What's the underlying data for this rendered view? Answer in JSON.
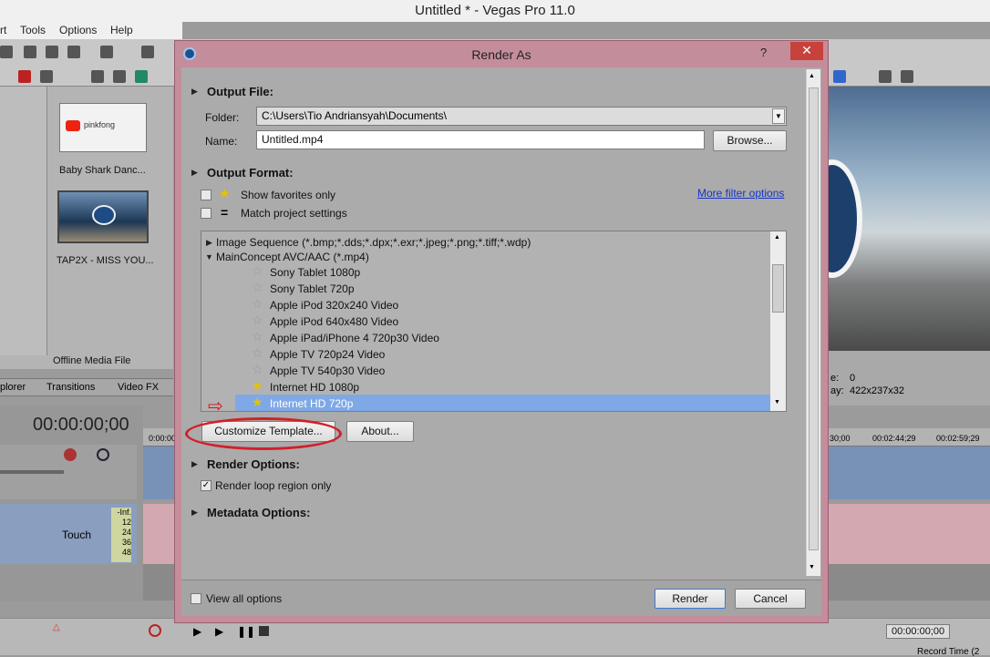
{
  "app": {
    "title": "Untitled * - Vegas Pro 11.0",
    "menu": [
      "rt",
      "Tools",
      "Options",
      "Help"
    ]
  },
  "media": {
    "items": [
      "Baby Shark Danc...",
      "TAP2X - MISS YOU..."
    ],
    "thumb1_text": "pinkfong",
    "panel_label": "Offline Media File",
    "tabs": [
      "plorer",
      "Transitions",
      "Video FX"
    ]
  },
  "timeline": {
    "timecode": "00:00:00;00",
    "touch_label": "Touch",
    "ruler_marks": [
      "0:00:00",
      "30;00",
      "00:02:44;29",
      "00:02:59;29"
    ],
    "level_marks": [
      "-Inf.",
      "12",
      "24",
      "36",
      "48"
    ],
    "bottom_time": "00:00:00;00",
    "record_time": "Record Time (2"
  },
  "preview_info": {
    "frame_label": "e:",
    "frame_value": "0",
    "display_label": "ay:",
    "display_value": "422x237x32"
  },
  "dialog": {
    "title": "Render As",
    "help_label": "?",
    "close_label": "✕",
    "output_file": {
      "header": "Output File:",
      "folder_label": "Folder:",
      "folder_value": "C:\\Users\\Tio Andriansyah\\Documents\\",
      "name_label": "Name:",
      "name_value": "Untitled.mp4",
      "browse_label": "Browse..."
    },
    "output_format": {
      "header": "Output Format:",
      "show_favorites_label": "Show favorites only",
      "match_project_label": "Match project settings",
      "more_filter_label": "More filter options",
      "list": [
        {
          "label": "Image Sequence (*.bmp;*.dds;*.dpx;*.exr;*.jpeg;*.png;*.tiff;*.wdp)",
          "type": "group",
          "expanded": false
        },
        {
          "label": "MainConcept AVC/AAC (*.mp4)",
          "type": "group",
          "expanded": true
        },
        {
          "label": "Sony Tablet 1080p",
          "type": "item",
          "favorite": false
        },
        {
          "label": "Sony Tablet 720p",
          "type": "item",
          "favorite": false
        },
        {
          "label": "Apple iPod 320x240 Video",
          "type": "item",
          "favorite": false
        },
        {
          "label": "Apple iPod 640x480 Video",
          "type": "item",
          "favorite": false
        },
        {
          "label": "Apple iPad/iPhone 4 720p30 Video",
          "type": "item",
          "favorite": false
        },
        {
          "label": "Apple TV 720p24 Video",
          "type": "item",
          "favorite": false
        },
        {
          "label": "Apple TV 540p30 Video",
          "type": "item",
          "favorite": false
        },
        {
          "label": "Internet HD 1080p",
          "type": "item",
          "favorite": true
        },
        {
          "label": "Internet HD 720p",
          "type": "item",
          "favorite": true,
          "selected": true
        }
      ],
      "customize_label": "Customize Template...",
      "about_label": "About..."
    },
    "render_options": {
      "header": "Render Options:",
      "loop_label": "Render loop region only",
      "loop_checked": true
    },
    "metadata_options": {
      "header": "Metadata Options:"
    },
    "footer": {
      "view_all_label": "View all options",
      "render_label": "Render",
      "cancel_label": "Cancel"
    }
  },
  "colors": {
    "dialog_frame": "#c48d9b",
    "selection": "#7fa8e6",
    "annotation_red": "#d1202a",
    "link": "#1535c9"
  }
}
